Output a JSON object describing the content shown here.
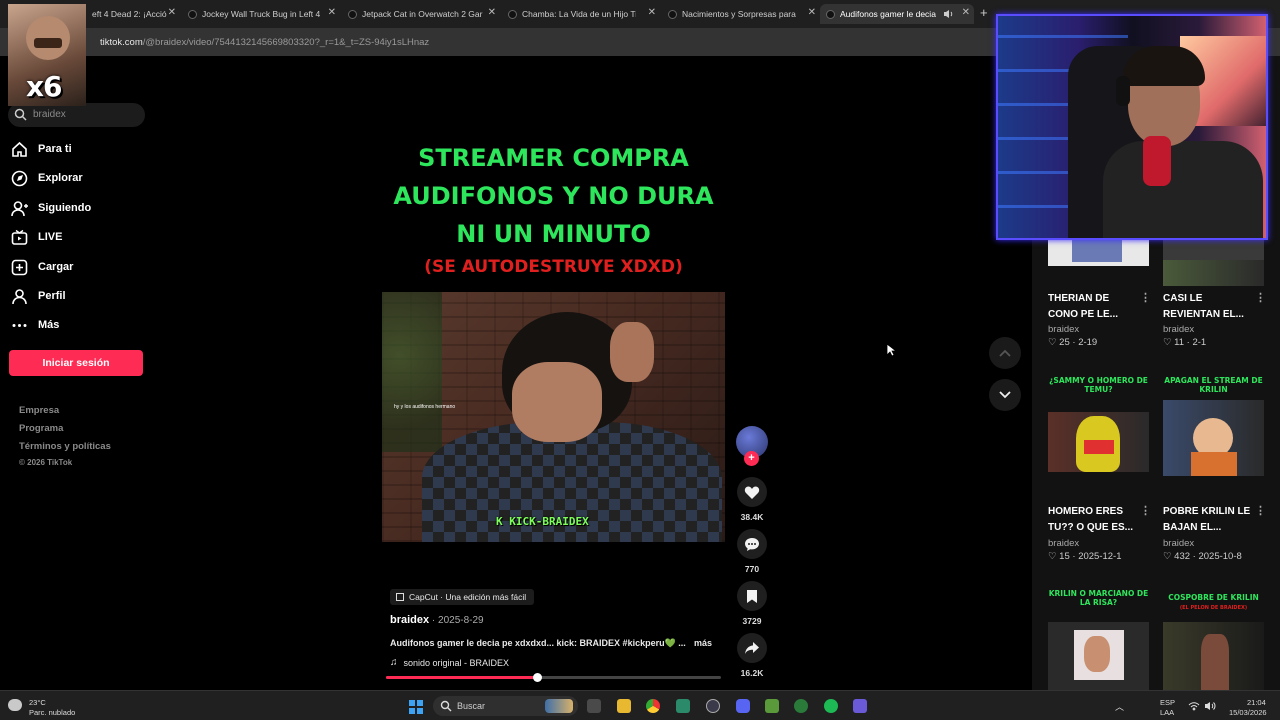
{
  "browser": {
    "tabs": [
      {
        "title": "Left 4 Dead 2: ¡Acción",
        "partial": "eft 4 Dead 2: ¡Acció"
      },
      {
        "title": "Jockey Wall Truck Bug in Left 4",
        "partial": "Jockey Wall Truck Bug in Left 4"
      },
      {
        "title": "Jetpack Cat in Overwatch 2 Gam",
        "partial": "Jetpack Cat in Overwatch 2 Gar"
      },
      {
        "title": "Chamba: La Vida de un Hijo Tra",
        "partial": "Chamba: La Vida de un Hijo Tra"
      },
      {
        "title": "Nacimientos y Sorpresas para N",
        "partial": "Nacimientos y Sorpresas para N"
      },
      {
        "title": "Audifonos gamer le decia p",
        "partial": "Audifonos gamer le decia p"
      }
    ],
    "close_glyph": "✕",
    "new_tab_glyph": "+",
    "url_host": "tiktok.com",
    "url_path": "/@braidex/video/7544132145669803320?_r=1&_t=ZS-94iy1sLHnaz"
  },
  "overlay": {
    "multiplier": "x6"
  },
  "sidebar": {
    "search_text": "braidex",
    "nav": [
      {
        "label": "Para ti",
        "icon": "home-icon"
      },
      {
        "label": "Explorar",
        "icon": "compass-icon"
      },
      {
        "label": "Siguiendo",
        "icon": "following-icon"
      },
      {
        "label": "LIVE",
        "icon": "live-icon"
      },
      {
        "label": "Cargar",
        "icon": "upload-icon"
      },
      {
        "label": "Perfil",
        "icon": "profile-icon"
      },
      {
        "label": "Más",
        "icon": "more-icon"
      }
    ],
    "login_label": "Iniciar sesión",
    "footer": [
      "Empresa",
      "Programa",
      "Términos y políticas"
    ],
    "copyright": "© 2026 TikTok"
  },
  "video": {
    "headline_lines": [
      "STREAMER COMPRA",
      "AUDIFONOS Y NO DURA",
      "NI UN MINUTO"
    ],
    "subline": "(SE AUTODESTRUYE XDXD)",
    "frame_caption": "hy y los audifonos hermano",
    "watermark": "K KICK-BRAIDEX",
    "capcut_label": "CapCut · Una edición más fácil",
    "author": "braidex",
    "date": " · 2025-8-29",
    "description": "Audifonos gamer le decia pe xdxdxd... kick: BRAIDEX #kickperu💚 ...",
    "more_label": "más",
    "music_note": "♫",
    "music": "sonido original - BRAIDEX",
    "progress": 0.45
  },
  "actions": {
    "likes": "38.4K",
    "comments": "770",
    "saves": "3729",
    "shares": "16.2K",
    "follow_plus": "+"
  },
  "recommendations": [
    {
      "title": "THERIAN DE CONO PE LE...",
      "author": "braidex",
      "likes": "25",
      "date": "2-19",
      "top": "",
      "top_sub": ""
    },
    {
      "title": "CASI LE REVIENTAN EL...",
      "author": "braidex",
      "likes": "11",
      "date": "2-1",
      "top": "",
      "top_sub": ""
    },
    {
      "title": "HOMERO ERES TU?? O QUE ES...",
      "author": "braidex",
      "likes": "15",
      "date": "2025-12-1",
      "top": "¿SAMMY O HOMERO DE TEMU?",
      "top_sub": ""
    },
    {
      "title": "POBRE KRILIN LE BAJAN EL...",
      "author": "braidex",
      "likes": "432",
      "date": "2025-10-8",
      "top": "APAGAN EL STREAM DE KRILIN",
      "top_sub": ""
    },
    {
      "title": "",
      "author": "",
      "likes": "",
      "date": "",
      "top": "KRILIN O MARCIANO DE LA RISA?",
      "top_sub": ""
    },
    {
      "title": "",
      "author": "",
      "likes": "",
      "date": "",
      "top": "COSPOBRE DE KRILIN",
      "top_sub": "(EL PELON DE BRAIDEX)"
    }
  ],
  "card_menu_glyph": "⋮",
  "stat_separator": " · ",
  "taskbar": {
    "temperature": "23°C",
    "weather": "Parc. nublado",
    "search_label": "Buscar",
    "lang_top": "ESP",
    "lang_bottom": "LAA",
    "time": "21:04",
    "date": "15/03/2026",
    "tray_arrow": "︿"
  },
  "colors": {
    "accent": "#fe2c55",
    "headline": "#2ee65c",
    "subline": "#e0201e"
  }
}
